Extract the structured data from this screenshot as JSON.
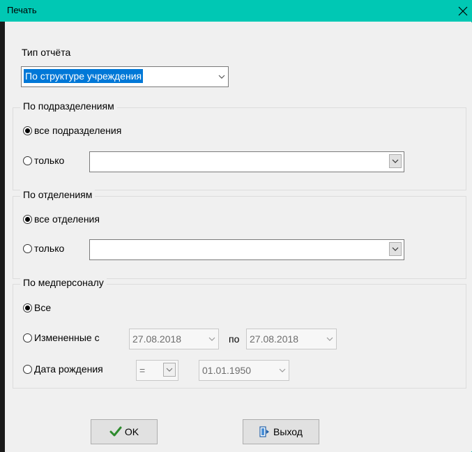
{
  "window": {
    "title": "Печать",
    "close_icon": "close-icon"
  },
  "report_type": {
    "label": "Тип отчёта",
    "selected": "По структуре учреждения"
  },
  "subdivisions": {
    "legend": "По подразделениям",
    "option_all": "все подразделения",
    "option_only": "только",
    "only_value": "",
    "selected": "all"
  },
  "departments": {
    "legend": "По отделениям",
    "option_all": "все отделения",
    "option_only": "только",
    "only_value": "",
    "selected": "all"
  },
  "staff": {
    "legend": "По медперсоналу",
    "option_all": "Все",
    "option_changed": "Измененные с",
    "changed_from": "27.08.2018",
    "to_label": "по",
    "changed_to": "27.08.2018",
    "option_birthdate": "Дата рождения",
    "operator": "=",
    "birthdate": "01.01.1950",
    "selected": "all"
  },
  "buttons": {
    "ok_label": "OK",
    "exit_label": "Выход",
    "ok_color": "#2e8b2e"
  }
}
